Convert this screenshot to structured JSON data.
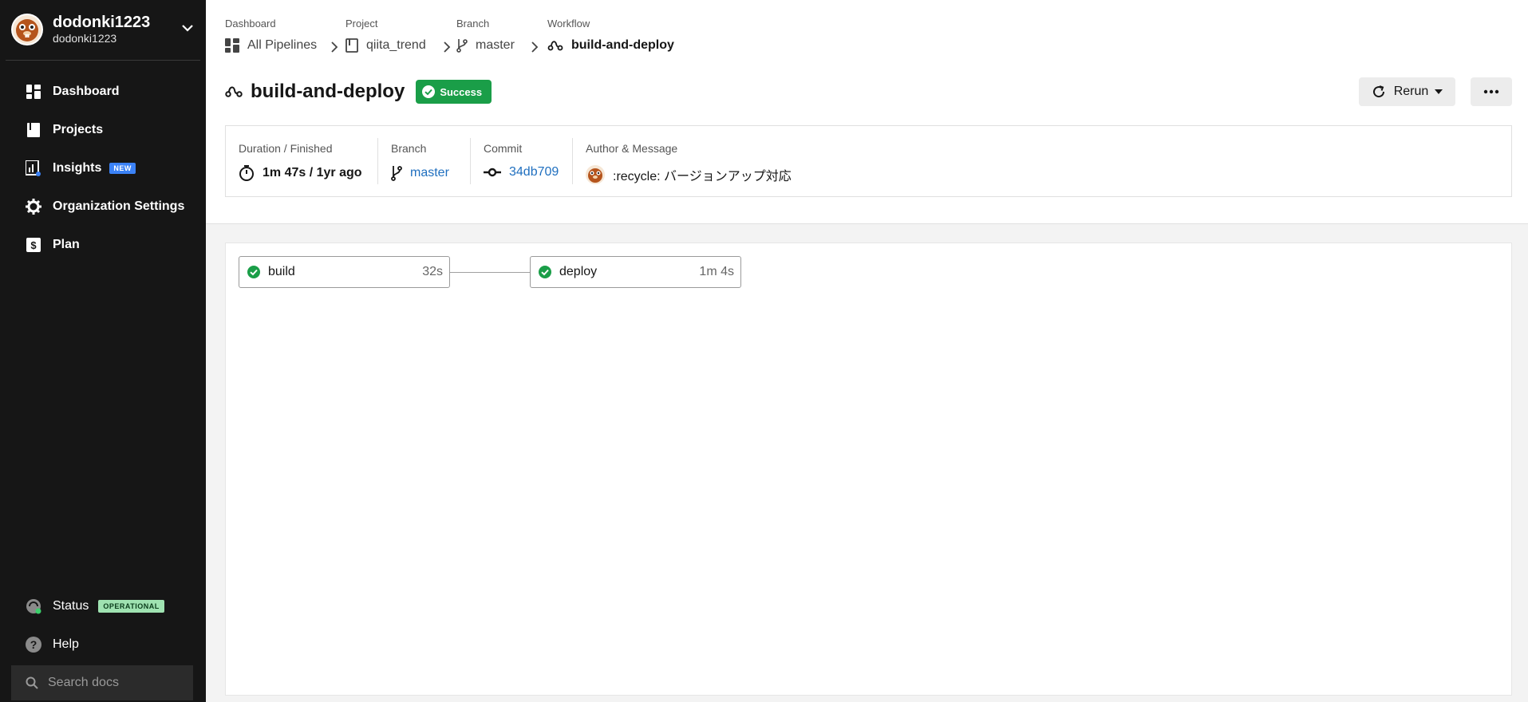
{
  "sidebar": {
    "org_name": "dodonki1223",
    "org_sub": "dodonki1223",
    "nav": [
      {
        "label": "Dashboard",
        "icon": "dashboard-icon"
      },
      {
        "label": "Projects",
        "icon": "projects-icon"
      },
      {
        "label": "Insights",
        "icon": "insights-icon",
        "badge": "NEW"
      },
      {
        "label": "Organization Settings",
        "icon": "gear-icon"
      },
      {
        "label": "Plan",
        "icon": "dollar-icon"
      }
    ],
    "status_label": "Status",
    "status_badge": "OPERATIONAL",
    "help_label": "Help",
    "search_placeholder": "Search docs"
  },
  "breadcrumb": {
    "dashboard": {
      "label": "Dashboard",
      "value": "All Pipelines"
    },
    "project": {
      "label": "Project",
      "value": "qiita_trend"
    },
    "branch": {
      "label": "Branch",
      "value": "master"
    },
    "workflow": {
      "label": "Workflow",
      "value": "build-and-deploy"
    }
  },
  "workflow": {
    "title": "build-and-deploy",
    "status": "Success",
    "rerun_label": "Rerun"
  },
  "info": {
    "duration": {
      "label": "Duration / Finished",
      "value": "1m 47s / 1yr ago"
    },
    "branch": {
      "label": "Branch",
      "value": "master"
    },
    "commit": {
      "label": "Commit",
      "value": "34db709"
    },
    "author": {
      "label": "Author & Message",
      "value": ":recycle: バージョンアップ対応"
    }
  },
  "jobs": [
    {
      "name": "build",
      "duration": "32s"
    },
    {
      "name": "deploy",
      "duration": "1m 4s"
    }
  ],
  "colors": {
    "success": "#1a9e48",
    "link": "#1f6fbf",
    "sidebar_bg": "#161616"
  }
}
